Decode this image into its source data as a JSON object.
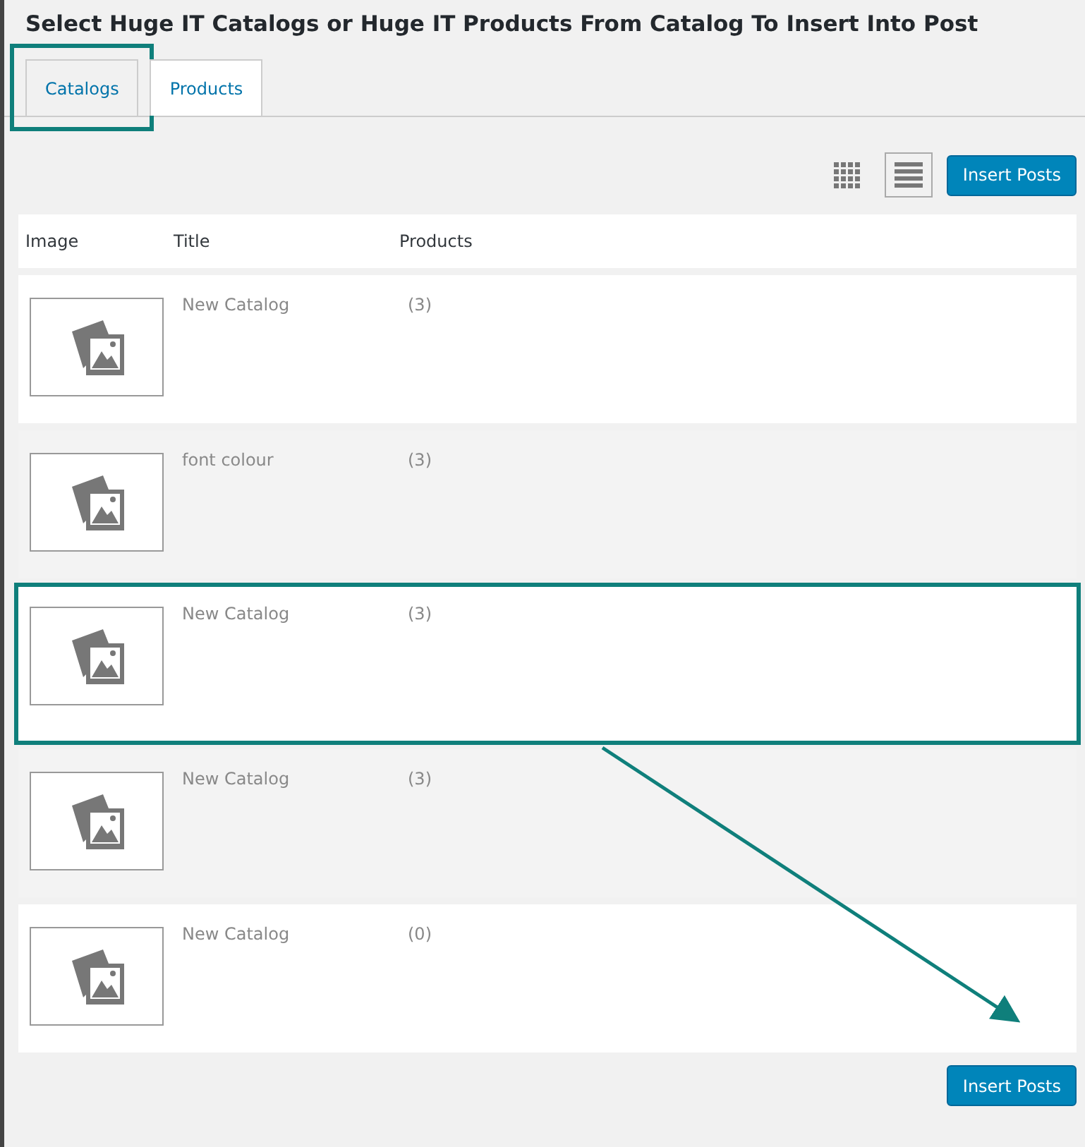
{
  "title": "Select Huge IT Catalogs or Huge IT Products From Catalog To Insert Into Post",
  "tabs": [
    {
      "label": "Catalogs",
      "selected": true,
      "highlighted": true
    },
    {
      "label": "Products",
      "selected": false,
      "highlighted": false
    }
  ],
  "view_toggle": [
    {
      "kind": "grid",
      "selected": false
    },
    {
      "kind": "list",
      "selected": true
    }
  ],
  "insert_button": "Insert Posts",
  "table": {
    "columns": [
      "Image",
      "Title",
      "Products"
    ],
    "rows": [
      {
        "title": "New Catalog",
        "products": "(3)",
        "highlighted": false
      },
      {
        "title": "font colour",
        "products": "(3)",
        "highlighted": false
      },
      {
        "title": "New Catalog",
        "products": "(3)",
        "highlighted": true
      },
      {
        "title": "New Catalog",
        "products": "(3)",
        "highlighted": false
      },
      {
        "title": "New Catalog",
        "products": "(0)",
        "highlighted": false
      }
    ]
  },
  "footer_button": "Insert Posts"
}
